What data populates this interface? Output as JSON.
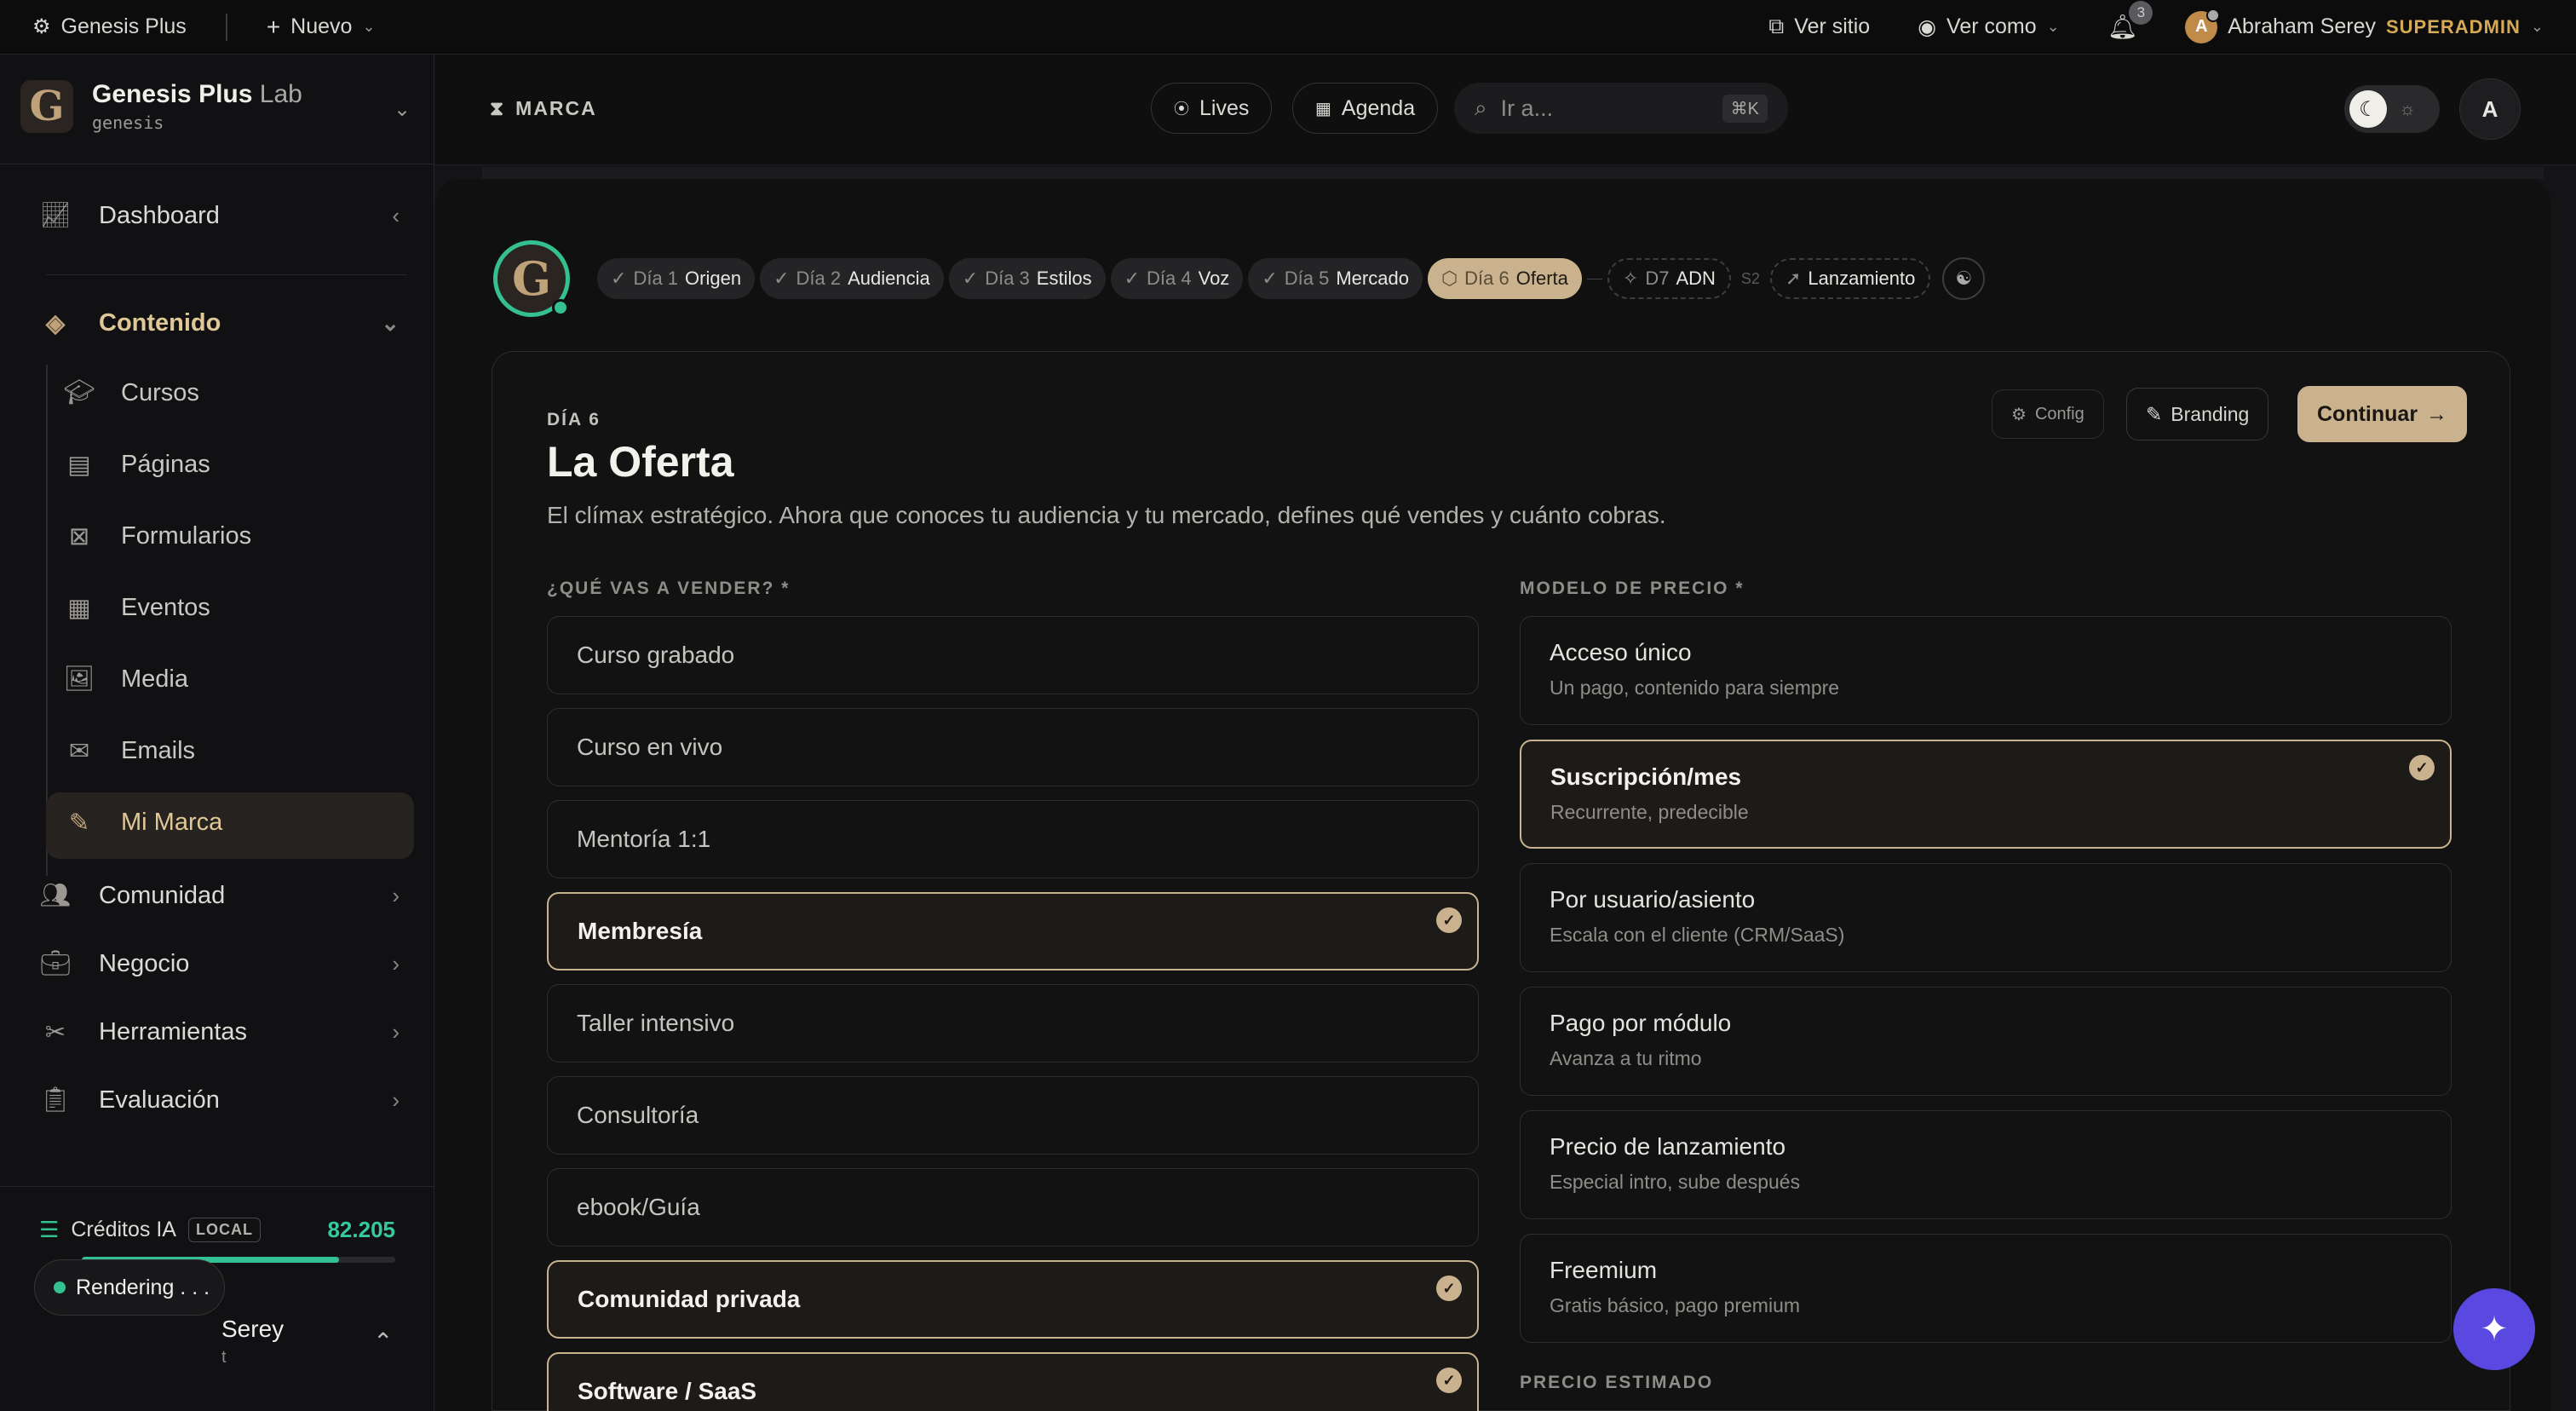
{
  "topbar": {
    "app_name": "Genesis Plus",
    "new_label": "Nuevo",
    "view_site": "Ver sitio",
    "view_as": "Ver como",
    "notifications_count": "3",
    "user_initial": "A",
    "user_name": "Abraham Serey",
    "role": "SUPERADMIN"
  },
  "sidebar": {
    "brand_name": "Genesis Plus",
    "brand_suffix": "Lab",
    "brand_slug": "genesis",
    "dashboard": "Dashboard",
    "content": "Contenido",
    "content_items": [
      {
        "label": "Cursos",
        "icon": "graduation-cap-icon"
      },
      {
        "label": "Páginas",
        "icon": "file-icon"
      },
      {
        "label": "Formularios",
        "icon": "form-icon"
      },
      {
        "label": "Eventos",
        "icon": "calendar-icon"
      },
      {
        "label": "Media",
        "icon": "images-icon"
      },
      {
        "label": "Emails",
        "icon": "envelope-icon"
      },
      {
        "label": "Mi Marca",
        "icon": "magic-wand-icon"
      }
    ],
    "sections": [
      {
        "label": "Comunidad",
        "icon": "users-icon"
      },
      {
        "label": "Negocio",
        "icon": "briefcase-icon"
      },
      {
        "label": "Herramientas",
        "icon": "tools-icon"
      },
      {
        "label": "Evaluación",
        "icon": "clipboard-check-icon"
      }
    ],
    "credits_label": "Créditos IA",
    "credits_badge": "LOCAL",
    "credits_value": "82.205",
    "credits_fraction": 0.82,
    "rendering_label": "Rendering . . .",
    "user_partial": "Serey",
    "user_partial_sub": "t"
  },
  "header": {
    "section": "MARCA",
    "lives": "Lives",
    "agenda": "Agenda",
    "search_placeholder": "Ir a...",
    "search_shortcut": "⌘K",
    "avatar_initial": "A"
  },
  "steps": [
    {
      "day": "Día 1",
      "name": "Origen"
    },
    {
      "day": "Día 2",
      "name": "Audiencia"
    },
    {
      "day": "Día 3",
      "name": "Estilos"
    },
    {
      "day": "Día 4",
      "name": "Voz"
    },
    {
      "day": "Día 5",
      "name": "Mercado"
    },
    {
      "day": "Día 6",
      "name": "Oferta"
    }
  ],
  "steps_extra": {
    "d7_day": "D7",
    "d7_name": "ADN",
    "s2": "S2",
    "launch": "Lanzamiento"
  },
  "card": {
    "day_label": "DÍA 6",
    "title": "La Oferta",
    "subtitle": "El clímax estratégico. Ahora que conoces tu audiencia y tu mercado, defines qué vendes y cuánto cobras.",
    "config_label": "Config",
    "branding_label": "Branding",
    "continue_label": "Continuar",
    "sell_label": "¿QUÉ VAS A VENDER? *",
    "pricing_label": "MODELO DE PRECIO *",
    "estimated_label": "PRECIO ESTIMADO"
  },
  "products": [
    {
      "label": "Curso grabado",
      "selected": false
    },
    {
      "label": "Curso en vivo",
      "selected": false
    },
    {
      "label": "Mentoría 1:1",
      "selected": false
    },
    {
      "label": "Membresía",
      "selected": true
    },
    {
      "label": "Taller intensivo",
      "selected": false
    },
    {
      "label": "Consultoría",
      "selected": false
    },
    {
      "label": "ebook/Guía",
      "selected": false
    },
    {
      "label": "Comunidad privada",
      "selected": true
    },
    {
      "label": "Software / SaaS",
      "selected": true
    }
  ],
  "pricing": [
    {
      "title": "Acceso único",
      "desc": "Un pago, contenido para siempre",
      "selected": false
    },
    {
      "title": "Suscripción/mes",
      "desc": "Recurrente, predecible",
      "selected": true
    },
    {
      "title": "Por usuario/asiento",
      "desc": "Escala con el cliente (CRM/SaaS)",
      "selected": false
    },
    {
      "title": "Pago por módulo",
      "desc": "Avanza a tu ritmo",
      "selected": false
    },
    {
      "title": "Precio de lanzamiento",
      "desc": "Especial intro, sube después",
      "selected": false
    },
    {
      "title": "Freemium",
      "desc": "Gratis básico, pago premium",
      "selected": false
    }
  ],
  "colors": {
    "accent": "#c9b28d",
    "success": "#34c08f",
    "fab": "#5a49e0"
  }
}
